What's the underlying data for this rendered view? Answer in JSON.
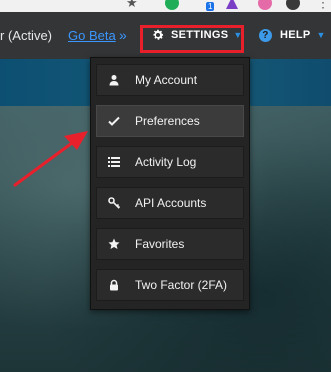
{
  "browser": {
    "extension_badge": "1"
  },
  "nav": {
    "status_text": "r (Active)",
    "go_beta_label": "Go Beta",
    "go_beta_chevron": "»",
    "settings_label": "SETTINGS",
    "help_label": "HELP"
  },
  "settings_menu": {
    "items": [
      {
        "label": "My Account",
        "icon": "user-icon"
      },
      {
        "label": "Preferences",
        "icon": "checkmark-icon"
      },
      {
        "label": "Activity Log",
        "icon": "list-icon"
      },
      {
        "label": "API Accounts",
        "icon": "key-icon"
      },
      {
        "label": "Favorites",
        "icon": "star-icon"
      },
      {
        "label": "Two Factor (2FA)",
        "icon": "lock-icon"
      }
    ],
    "active_item": "Preferences"
  },
  "annotation": {
    "highlight_color": "#e8202b",
    "arrow_color": "#e8202b"
  }
}
